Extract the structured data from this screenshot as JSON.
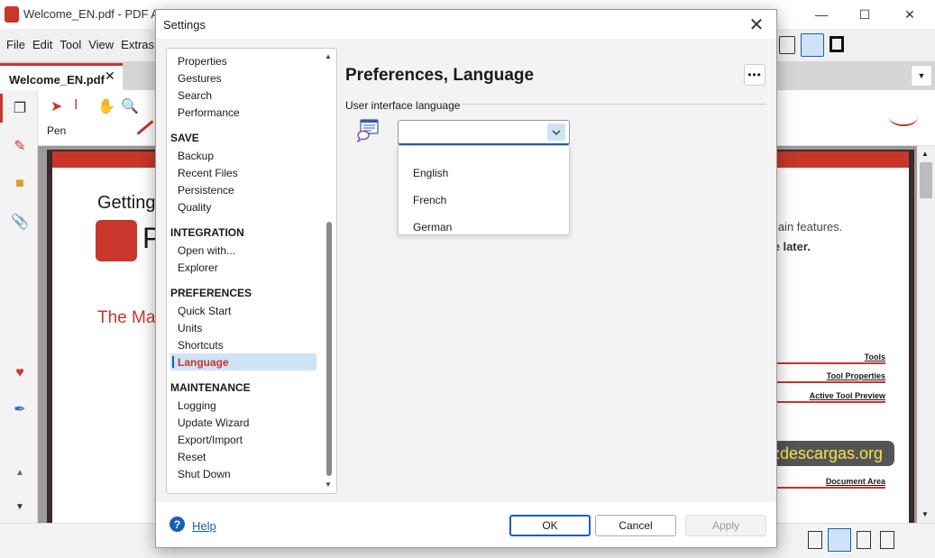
{
  "app": {
    "title": "Welcome_EN.pdf - PDF Ann",
    "menu": [
      "File",
      "Edit",
      "Tool",
      "View",
      "Extras"
    ],
    "doc_tab": "Welcome_EN.pdf",
    "toolbar_label": "Pen",
    "accent_color": "#c9362b"
  },
  "document": {
    "heading_partial": "Getting",
    "logo_letter": "P",
    "subheading_partial": "The Ma",
    "text_line1": "main features.",
    "text_line2": "le later.",
    "legend": [
      "Tools",
      "Tool Properties",
      "Active Tool Preview",
      "Document Area"
    ]
  },
  "watermark": "www.zdescargas.org",
  "dialog": {
    "title": "Settings",
    "categories": {
      "top_items": [
        "Properties",
        "Gestures",
        "Search",
        "Performance"
      ],
      "save_head": "SAVE",
      "save_items": [
        "Backup",
        "Recent Files",
        "Persistence",
        "Quality"
      ],
      "integration_head": "INTEGRATION",
      "integration_items": [
        "Open with...",
        "Explorer"
      ],
      "preferences_head": "PREFERENCES",
      "preferences_items": [
        "Quick Start",
        "Units",
        "Shortcuts",
        "Language"
      ],
      "maintenance_head": "MAINTENANCE",
      "maintenance_items": [
        "Logging",
        "Update Wizard",
        "Export/Import",
        "Reset",
        "Shut Down"
      ],
      "selected": "Language"
    },
    "panel": {
      "title": "Preferences, Language",
      "group_label": "User interface language",
      "combo_value": "",
      "options": [
        "English",
        "French",
        "German"
      ]
    },
    "footer": {
      "help": "Help",
      "ok": "OK",
      "cancel": "Cancel",
      "apply": "Apply"
    }
  }
}
